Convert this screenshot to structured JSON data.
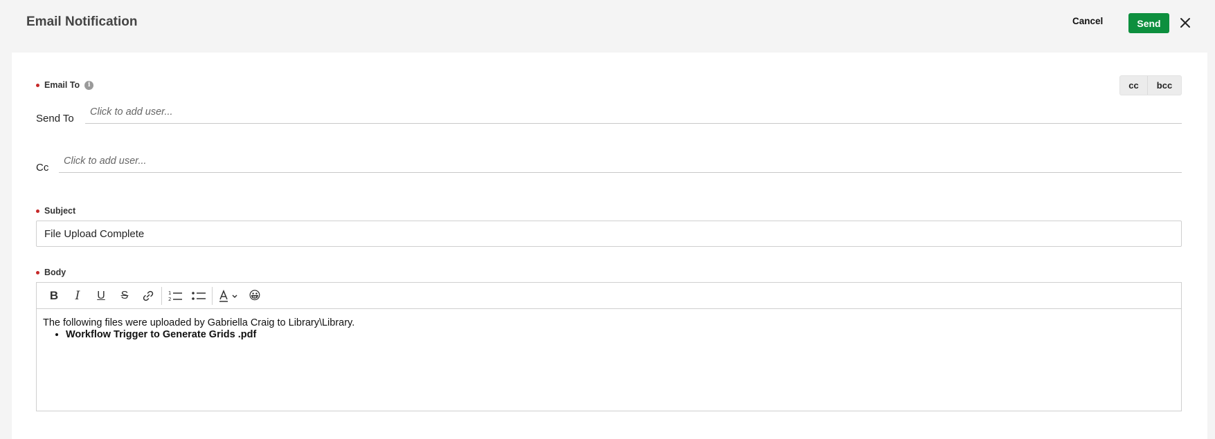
{
  "header": {
    "title": "Email Notification",
    "cancel_label": "Cancel",
    "send_label": "Send"
  },
  "email_to": {
    "label": "Email To",
    "info": "i",
    "cc_toggle": "cc",
    "bcc_toggle": "bcc"
  },
  "send_to": {
    "label": "Send To",
    "placeholder": "Click to add user..."
  },
  "cc": {
    "label": "Cc",
    "placeholder": "Click to add user..."
  },
  "subject": {
    "label": "Subject",
    "value": "File Upload Complete"
  },
  "body": {
    "label": "Body",
    "text": "The following files were uploaded by Gabriella Craig to Library\\Library.",
    "files": [
      "Workflow Trigger to Generate Grids .pdf"
    ]
  },
  "toolbar": {
    "bold": "B",
    "italic": "I",
    "underline": "U",
    "strike": "S",
    "emoji": "😀"
  },
  "colors": {
    "send_button": "#0d8f3e",
    "required_dot": "#c62828"
  }
}
